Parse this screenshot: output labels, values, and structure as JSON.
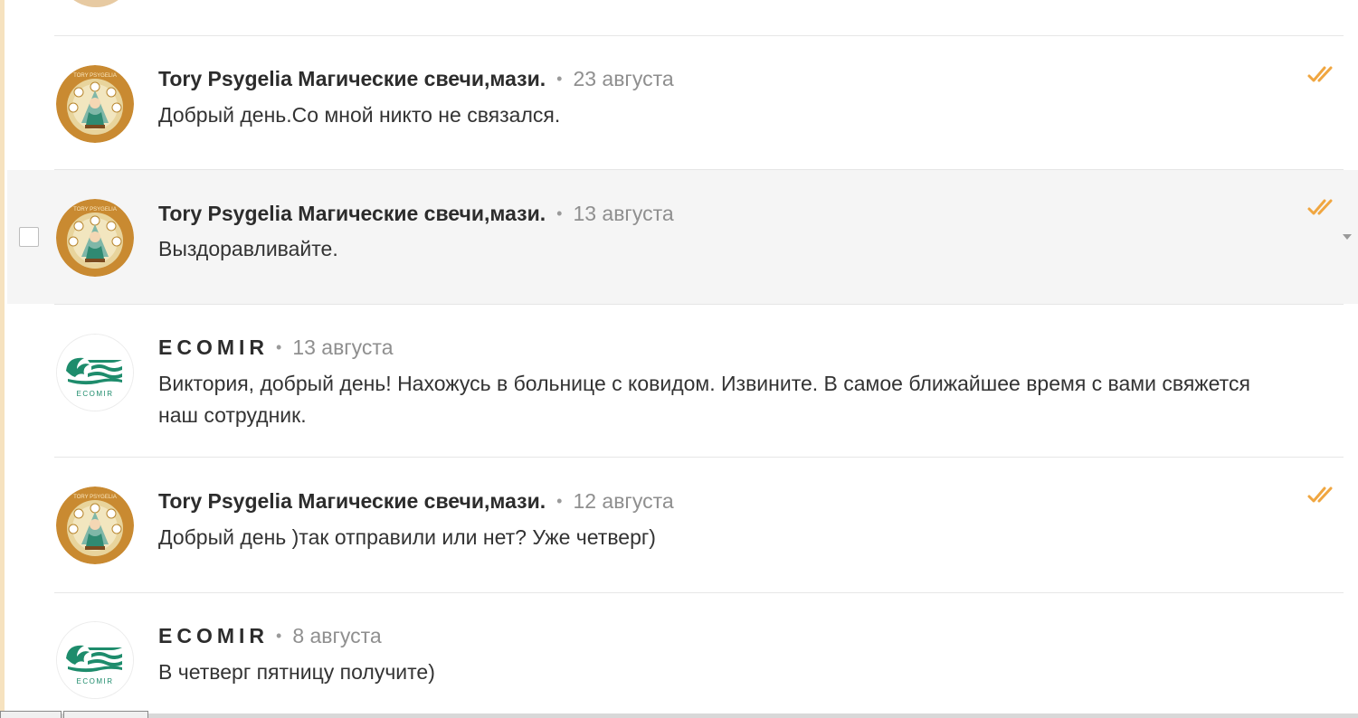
{
  "colors": {
    "accent": "#f0a640",
    "brand_green": "#1e8c6c",
    "avatar_brown": "#c98a31",
    "highlight_row": "#f5f5f5"
  },
  "icons": {
    "read_mark": "double-check-icon",
    "avatar_tory": "tory-psygelia-avatar",
    "avatar_ecomir": "ecomir-logo-avatar"
  },
  "messages": [
    {
      "sender": "Tory Psygelia Магические свечи,мази.",
      "separator": "•",
      "date": "23 августа",
      "text": "Добрый день.Со мной никто не связался.",
      "read": true
    },
    {
      "sender": "Tory Psygelia Магические свечи,мази.",
      "separator": "•",
      "date": "13 августа",
      "text": "Выздоравливайте.",
      "read": true,
      "hovered": true
    },
    {
      "sender": "ECOMIR",
      "separator": "•",
      "date": "13 августа",
      "text": "Виктория, добрый день! Нахожусь в больнице с ковидом. Извините. В самое ближайшее время с вами свяжется наш сотрудник.",
      "read": false
    },
    {
      "sender": "Tory Psygelia Магические свечи,мази.",
      "separator": "•",
      "date": "12 августа",
      "text": "Добрый день )так отправили или нет? Уже четверг)",
      "read": true
    },
    {
      "sender": "ECOMIR",
      "separator": "•",
      "date": "8 августа",
      "text": "В четверг пятницу получите)",
      "read": false
    }
  ],
  "tory_avatar_caption": "TORY PSYGELIA",
  "ecomir_avatar_caption": "ECOMIR"
}
